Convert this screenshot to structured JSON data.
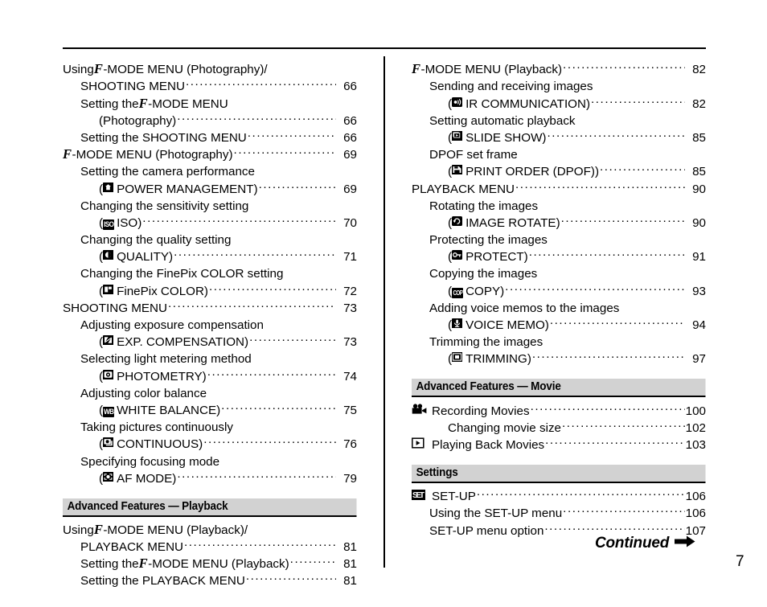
{
  "document": {
    "page_number": "7",
    "continued_label": "Continued",
    "continued_arrow_icon": "right-arrow-icon"
  },
  "left_column": {
    "entries": [
      {
        "indent": 0,
        "text_before": "Using ",
        "fmode": true,
        "text_after": "-MODE MENU (Photography)/",
        "page": "",
        "leader": false
      },
      {
        "indent": 1,
        "text_before": "SHOOTING MENU",
        "fmode": false,
        "text_after": "",
        "page": "66",
        "leader": true
      },
      {
        "indent": 1,
        "text_before": "Setting the ",
        "fmode": true,
        "text_after": "-MODE MENU",
        "page": "",
        "leader": false
      },
      {
        "indent": 2,
        "text_before": "(Photography) ",
        "fmode": false,
        "text_after": "",
        "page": "66",
        "leader": true
      },
      {
        "indent": 1,
        "text_before": "Setting the SHOOTING MENU",
        "fmode": false,
        "text_after": "",
        "page": "66",
        "leader": true
      },
      {
        "indent": 0,
        "text_before": "",
        "fmode": true,
        "text_after": "-MODE MENU (Photography)",
        "page": "69",
        "leader": true
      },
      {
        "indent": 1,
        "text_before": "Setting the camera performance",
        "fmode": false,
        "text_after": "",
        "page": "",
        "leader": false
      },
      {
        "indent": 2,
        "text_before": "(",
        "icon": "power-management-icon",
        "icon_label": "",
        "text_after": " POWER MANAGEMENT) ",
        "page": "69",
        "leader": true
      },
      {
        "indent": 1,
        "text_before": "Changing the sensitivity setting",
        "fmode": false,
        "text_after": "",
        "page": "",
        "leader": false
      },
      {
        "indent": 2,
        "text_before": "(",
        "icon": "iso-icon",
        "icon_label": "ISO",
        "text_after": " ISO) ",
        "page": "70",
        "leader": true
      },
      {
        "indent": 1,
        "text_before": "Changing the quality setting",
        "fmode": false,
        "text_after": "",
        "page": "",
        "leader": false
      },
      {
        "indent": 2,
        "text_before": "(",
        "icon": "quality-icon",
        "icon_label": "",
        "text_after": " QUALITY) ",
        "page": "71",
        "leader": true
      },
      {
        "indent": 1,
        "text_before": "Changing the FinePix COLOR setting",
        "fmode": false,
        "text_after": "",
        "page": "",
        "leader": false
      },
      {
        "indent": 2,
        "text_before": "(",
        "icon": "finepix-color-icon",
        "icon_label": "",
        "text_after": " FinePix COLOR)",
        "page": "72",
        "leader": true
      },
      {
        "indent": 0,
        "text_before": "SHOOTING MENU ",
        "fmode": false,
        "text_after": "",
        "page": "73",
        "leader": true
      },
      {
        "indent": 1,
        "text_before": "Adjusting exposure compensation",
        "fmode": false,
        "text_after": "",
        "page": "",
        "leader": false
      },
      {
        "indent": 2,
        "text_before": "(",
        "icon": "exposure-compensation-icon",
        "icon_label": "",
        "text_after": " EXP. COMPENSATION) ",
        "page": "73",
        "leader": true
      },
      {
        "indent": 1,
        "text_before": "Selecting light metering method",
        "fmode": false,
        "text_after": "",
        "page": "",
        "leader": false
      },
      {
        "indent": 2,
        "text_before": "(",
        "icon": "photometry-icon",
        "icon_label": "",
        "text_after": " PHOTOMETRY) ",
        "page": "74",
        "leader": true
      },
      {
        "indent": 1,
        "text_before": "Adjusting color balance",
        "fmode": false,
        "text_after": "",
        "page": "",
        "leader": false
      },
      {
        "indent": 2,
        "text_before": "(",
        "icon": "white-balance-icon",
        "icon_label": "WB",
        "text_after": " WHITE BALANCE) ",
        "page": "75",
        "leader": true
      },
      {
        "indent": 1,
        "text_before": "Taking pictures continuously",
        "fmode": false,
        "text_after": "",
        "page": "",
        "leader": false
      },
      {
        "indent": 2,
        "text_before": "(",
        "icon": "continuous-icon",
        "icon_label": "",
        "text_after": " CONTINUOUS)",
        "page": "76",
        "leader": true
      },
      {
        "indent": 1,
        "text_before": "Specifying focusing mode",
        "fmode": false,
        "text_after": "",
        "page": "",
        "leader": false
      },
      {
        "indent": 2,
        "text_before": "(",
        "icon": "af-mode-icon",
        "icon_label": "",
        "text_after": " AF MODE)",
        "page": "79",
        "leader": true
      }
    ],
    "section": {
      "title": "Advanced Features — Playback",
      "entries": [
        {
          "indent": 0,
          "text_before": "Using ",
          "fmode": true,
          "text_after": "-MODE MENU (Playback)/",
          "page": "",
          "leader": false
        },
        {
          "indent": 1,
          "text_before": "PLAYBACK MENU ",
          "fmode": false,
          "text_after": "",
          "page": "81",
          "leader": true
        },
        {
          "indent": 1,
          "text_before": "Setting the ",
          "fmode": true,
          "text_after": "-MODE MENU (Playback) ",
          "page": "81",
          "leader": true
        },
        {
          "indent": 1,
          "text_before": "Setting the PLAYBACK MENU ",
          "fmode": false,
          "text_after": "",
          "page": "81",
          "leader": true
        }
      ]
    }
  },
  "right_column": {
    "entries": [
      {
        "indent": 0,
        "text_before": "",
        "fmode": true,
        "text_after": "-MODE MENU (Playback)",
        "page": "82",
        "leader": true
      },
      {
        "indent": 1,
        "text_before": "Sending and receiving images",
        "fmode": false,
        "text_after": "",
        "page": "",
        "leader": false
      },
      {
        "indent": 2,
        "text_before": "(",
        "icon": "ir-communication-icon",
        "icon_label": "",
        "text_after": " IR COMMUNICATION) ",
        "page": "82",
        "leader": true
      },
      {
        "indent": 1,
        "text_before": "Setting automatic playback",
        "fmode": false,
        "text_after": "",
        "page": "",
        "leader": false
      },
      {
        "indent": 2,
        "text_before": "(",
        "icon": "slide-show-icon",
        "icon_label": "",
        "text_after": " SLIDE SHOW) ",
        "page": "85",
        "leader": true
      },
      {
        "indent": 1,
        "text_before": "DPOF set frame",
        "fmode": false,
        "text_after": "",
        "page": "",
        "leader": false
      },
      {
        "indent": 2,
        "text_before": "(",
        "icon": "print-order-icon",
        "icon_label": "",
        "text_after": " PRINT ORDER (DPOF))",
        "page": "85",
        "leader": true
      },
      {
        "indent": 0,
        "text_before": "PLAYBACK MENU",
        "fmode": false,
        "text_after": "",
        "page": "90",
        "leader": true
      },
      {
        "indent": 1,
        "text_before": "Rotating the images",
        "fmode": false,
        "text_after": "",
        "page": "",
        "leader": false
      },
      {
        "indent": 2,
        "text_before": "(",
        "icon": "image-rotate-icon",
        "icon_label": "",
        "text_after": " IMAGE ROTATE)",
        "page": "90",
        "leader": true
      },
      {
        "indent": 1,
        "text_before": "Protecting the images",
        "fmode": false,
        "text_after": "",
        "page": "",
        "leader": false
      },
      {
        "indent": 2,
        "text_before": "(",
        "icon": "protect-icon",
        "icon_label": "",
        "text_after": " PROTECT)",
        "page": "91",
        "leader": true
      },
      {
        "indent": 1,
        "text_before": "Copying the images",
        "fmode": false,
        "text_after": "",
        "page": "",
        "leader": false
      },
      {
        "indent": 2,
        "text_before": "(",
        "icon": "copy-icon",
        "icon_label": "COPY",
        "text_after": " COPY) ",
        "page": "93",
        "leader": true
      },
      {
        "indent": 1,
        "text_before": "Adding voice memos to the images",
        "fmode": false,
        "text_after": "",
        "page": "",
        "leader": false
      },
      {
        "indent": 2,
        "text_before": "(",
        "icon": "voice-memo-icon",
        "icon_label": "",
        "text_after": " VOICE MEMO)",
        "page": "94",
        "leader": true
      },
      {
        "indent": 1,
        "text_before": "Trimming the images",
        "fmode": false,
        "text_after": "",
        "page": "",
        "leader": false
      },
      {
        "indent": 2,
        "text_before": "(",
        "icon": "trimming-icon",
        "icon_label": "",
        "text_after": " TRIMMING)",
        "page": "97",
        "leader": true
      }
    ],
    "movie_section": {
      "title": "Advanced Features — Movie",
      "entries": [
        {
          "indent": 0,
          "bigicon": "movie-camera-icon",
          "text_before": "Recording Movies ",
          "text_after": "",
          "page": "100",
          "leader": true
        },
        {
          "indent": 2,
          "text_before": "Changing movie size",
          "text_after": "",
          "page": "102",
          "leader": true
        },
        {
          "indent": 0,
          "bigicon": "playback-icon",
          "text_before": "Playing Back Movies",
          "text_after": "",
          "page": "103",
          "leader": true
        }
      ]
    },
    "settings_section": {
      "title": "Settings",
      "entries": [
        {
          "indent": 0,
          "bigicon": "setup-icon",
          "text_before": "SET-UP",
          "text_after": "",
          "page": "106",
          "leader": true
        },
        {
          "indent": 1,
          "text_before": "Using the SET-UP menu",
          "text_after": "",
          "page": "106",
          "leader": true
        },
        {
          "indent": 1,
          "text_before": "SET-UP menu option ",
          "text_after": "",
          "page": "107",
          "leader": true
        }
      ]
    }
  },
  "colors": {
    "section_bar_bg": "#d2d2d2",
    "text": "#000000",
    "page_bg": "#ffffff"
  }
}
